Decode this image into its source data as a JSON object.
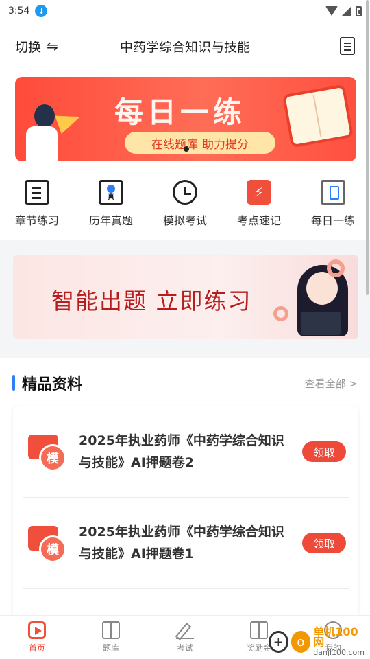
{
  "status_bar": {
    "time": "3:54"
  },
  "header": {
    "switch_label": "切换",
    "title": "中药学综合知识与技能"
  },
  "banner": {
    "title": "每日一练",
    "tag_left": "在线题库",
    "tag_right": "助力提分"
  },
  "categories": [
    {
      "label": "章节练习",
      "icon": "chapter-icon"
    },
    {
      "label": "历年真题",
      "icon": "past-exam-icon",
      "glyph": "真"
    },
    {
      "label": "模拟考试",
      "icon": "clock-icon"
    },
    {
      "label": "考点速记",
      "icon": "flash-icon"
    },
    {
      "label": "每日一练",
      "icon": "daily-icon"
    }
  ],
  "promo_banner": {
    "text": "智能出题  立即练习"
  },
  "section": {
    "title": "精品资料",
    "more": "查看全部 >"
  },
  "materials": [
    {
      "icon_glyph": "模",
      "title": "2025年执业药师《中药学综合知识与技能》AI押题卷2",
      "action": "领取"
    },
    {
      "icon_glyph": "模",
      "title": "2025年执业药师《中药学综合知识与技能》AI押题卷1",
      "action": "领取"
    }
  ],
  "bottom_nav": [
    {
      "label": "首页",
      "active": true
    },
    {
      "label": "题库",
      "active": false
    },
    {
      "label": "考试",
      "active": false
    },
    {
      "label": "奖励金",
      "active": false
    },
    {
      "label": "我的",
      "active": false
    }
  ],
  "watermark": {
    "brand": "单机100网",
    "url": "danji100.com"
  },
  "colors": {
    "accent": "#f0503b",
    "blue": "#2d7ff9"
  }
}
